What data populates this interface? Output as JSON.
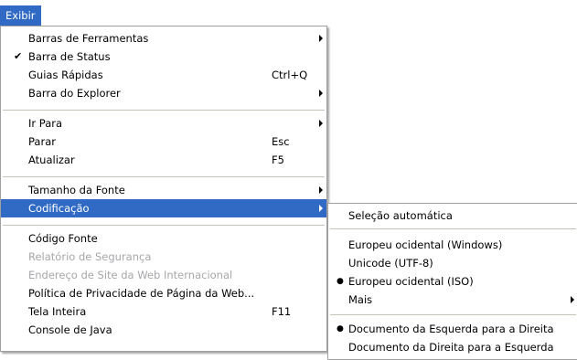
{
  "menubar": {
    "exibir_label": "Exibir"
  },
  "menu": {
    "items": [
      {
        "label": "Barras de Ferramentas"
      },
      {
        "label": "Barra de Status"
      },
      {
        "label": "Guias Rápidas",
        "shortcut": "Ctrl+Q"
      },
      {
        "label": "Barra do Explorer"
      },
      {
        "label": "Ir Para"
      },
      {
        "label": "Parar",
        "shortcut": "Esc"
      },
      {
        "label": "Atualizar",
        "shortcut": "F5"
      },
      {
        "label": "Tamanho da Fonte"
      },
      {
        "label": "Codificação"
      },
      {
        "label": "Código Fonte"
      },
      {
        "label": "Relatório de Segurança"
      },
      {
        "label": "Endereço de Site da Web Internacional"
      },
      {
        "label": "Política de Privacidade de Página da Web..."
      },
      {
        "label": "Tela Inteira",
        "shortcut": "F11"
      },
      {
        "label": "Console de Java"
      }
    ]
  },
  "submenu": {
    "items": [
      {
        "label": "Seleção automática"
      },
      {
        "label": "Europeu ocidental (Windows)"
      },
      {
        "label": "Unicode (UTF-8)"
      },
      {
        "label": "Europeu ocidental (ISO)"
      },
      {
        "label": "Mais"
      },
      {
        "label": "Documento da Esquerda para a Direita"
      },
      {
        "label": "Documento da Direita para a Esquerda"
      }
    ]
  },
  "icons": {
    "check": "checkmark-icon",
    "bullet": "radio-bullet-icon",
    "submenu_arrow": "submenu-arrow-icon"
  },
  "colors": {
    "highlight": "#316ac5",
    "disabled_text": "#a7a6aa",
    "separator": "#c5c2b8"
  }
}
